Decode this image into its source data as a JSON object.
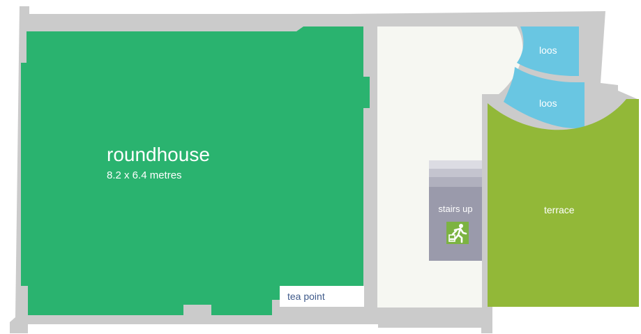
{
  "rooms": {
    "roundhouse": {
      "name": "roundhouse",
      "size": "8.2 x 6.4 metres"
    },
    "tea_point": "tea point",
    "loos_upper": "loos",
    "loos_lower": "loos",
    "stairs": "stairs up",
    "terrace": "terrace"
  },
  "icons": {
    "exit": "emergency-exit-icon"
  },
  "colors": {
    "wall": "#cbcbcb",
    "roundhouse": "#2ab36f",
    "corridor": "#f6f7f2",
    "loos": "#69c6e2",
    "terrace": "#92b838",
    "stairs": "#9a9aab",
    "exit_sign": "#7cb342",
    "tea_point": "#ffffff"
  }
}
